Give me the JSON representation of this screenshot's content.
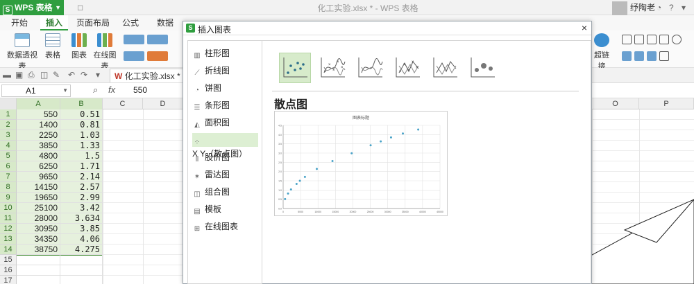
{
  "titlebar": {
    "app_name": "WPS 表格",
    "app_logo_letter": "S",
    "document_title": "化工实验.xlsx * - WPS 表格",
    "user_name": "纾陶老"
  },
  "menu_tabs": [
    "开始",
    "插入",
    "页面布局",
    "公式",
    "数据"
  ],
  "active_menu_tab": "插入",
  "ribbon": {
    "pivot_table": "数据透视表",
    "table": "表格",
    "chart": "图表",
    "online_chart": "在线图表",
    "hyperlink": "超链接"
  },
  "quickbar": {
    "file_tab": "化工实验.xlsx *",
    "close": "×"
  },
  "formula_bar": {
    "cell_ref": "A1",
    "fx": "fx",
    "value": "550"
  },
  "sheet": {
    "columns": [
      "A",
      "B",
      "C",
      "D",
      "O",
      "P"
    ],
    "row_numbers": [
      "1",
      "2",
      "3",
      "4",
      "5",
      "6",
      "7",
      "8",
      "9",
      "10",
      "11",
      "12",
      "13",
      "14",
      "15",
      "16",
      "17"
    ],
    "col_a": [
      "550",
      "1400",
      "2250",
      "3850",
      "4800",
      "6250",
      "9650",
      "14150",
      "19650",
      "25100",
      "28000",
      "30950",
      "34350",
      "38750"
    ],
    "col_b": [
      "0.51",
      "0.81",
      "1.03",
      "1.33",
      "1.5",
      "1.71",
      "2.14",
      "2.57",
      "2.99",
      "3.42",
      "3.634",
      "3.85",
      "4.06",
      "4.275"
    ]
  },
  "dialog": {
    "logo_letter": "S",
    "title": "插入图表",
    "close": "×",
    "nav": [
      {
        "label": "柱形图",
        "icon": "column-chart-icon"
      },
      {
        "label": "折线图",
        "icon": "line-chart-icon"
      },
      {
        "label": "饼图",
        "icon": "pie-chart-icon"
      },
      {
        "label": "条形图",
        "icon": "bar-chart-icon"
      },
      {
        "label": "面积图",
        "icon": "area-chart-icon"
      },
      {
        "label": "X Y（散点图）",
        "icon": "scatter-chart-icon"
      },
      {
        "label": "股价图",
        "icon": "stock-chart-icon"
      },
      {
        "label": "雷达图",
        "icon": "radar-chart-icon"
      },
      {
        "label": "组合图",
        "icon": "combo-chart-icon"
      },
      {
        "label": "模板",
        "icon": "template-icon"
      },
      {
        "label": "在线图表",
        "icon": "online-chart-icon"
      }
    ],
    "active_nav": "X Y（散点图）",
    "section_title": "散点图",
    "preview_title": "图表标题",
    "subtypes": [
      "scatter-markers",
      "scatter-smooth-markers",
      "scatter-smooth",
      "scatter-straight-markers",
      "scatter-straight",
      "bubble"
    ]
  },
  "chart_data": {
    "type": "scatter",
    "title": "图表标题",
    "x": [
      550,
      1400,
      2250,
      3850,
      4800,
      6250,
      9650,
      14150,
      19650,
      25100,
      28000,
      30950,
      34350,
      38750
    ],
    "y": [
      0.51,
      0.81,
      1.03,
      1.33,
      1.5,
      1.71,
      2.14,
      2.57,
      2.99,
      3.42,
      3.634,
      3.85,
      4.06,
      4.275
    ],
    "xlim": [
      0,
      45000
    ],
    "ylim": [
      0,
      4.5
    ],
    "grid": true,
    "color": "#4aa3c8"
  }
}
